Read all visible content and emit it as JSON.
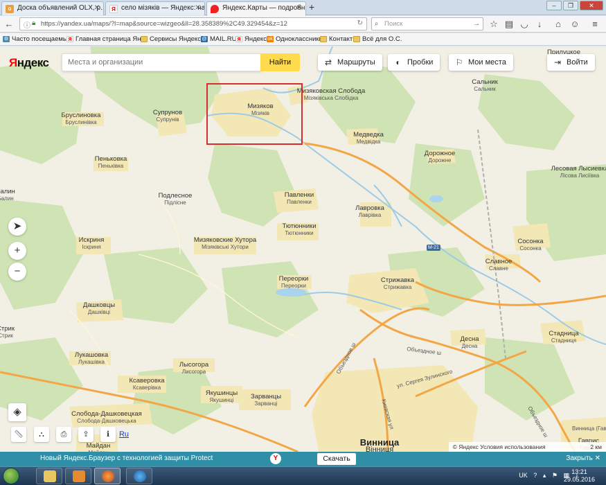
{
  "browser": {
    "tabs": [
      {
        "label": "Доска объявлений OLX, р..."
      },
      {
        "label": "село мізяків — Яндекс: на..."
      },
      {
        "label": "Яндекс.Карты — подробн..."
      }
    ],
    "url": "https://yandex.ua/maps/?l=map&source=wizgeo&ll=28.358389%2C49.329454&z=12",
    "search_placeholder": "Поиск",
    "bookmarks": [
      "Часто посещаемые",
      "Главная страница Ян...",
      "Сервисы Яндекса",
      "MAIL.RU",
      "Яндекс",
      "Одноклассники",
      "Контакт",
      "Всё для О.С."
    ]
  },
  "yandex": {
    "logo_prefix": "Я",
    "logo_rest": "ндекс",
    "search_placeholder": "Места и организации",
    "find_label": "Найти",
    "routes_label": "Маршруты",
    "traffic_label": "Пробки",
    "my_places_label": "Мои места",
    "login_label": "Войти",
    "lang_label": "Ru",
    "copyright": "© Яндекс Условия использования",
    "scale": "2 км"
  },
  "places": [
    {
      "ru": "Мизяков",
      "ua": "Мізяків"
    },
    {
      "ru": "Мизяковская Слобода",
      "ua": "Мізяківська Слобідка"
    },
    {
      "ru": "Супрунов",
      "ua": "Супрунів"
    },
    {
      "ru": "Бруслиновка",
      "ua": "Бруслинівка"
    },
    {
      "ru": "Пеньковка",
      "ua": "Пеньківка"
    },
    {
      "ru": "Медведка",
      "ua": "Медвідка"
    },
    {
      "ru": "Сальник",
      "ua": "Сальник"
    },
    {
      "ru": "Дорожное",
      "ua": "Дорожне"
    },
    {
      "ru": "Лесовая Лысиевка",
      "ua": "Лісова Лисіївка"
    },
    {
      "ru": "Балин",
      "ua": "Балин"
    },
    {
      "ru": "Подлесное",
      "ua": "Підлісне"
    },
    {
      "ru": "Павленки",
      "ua": "Павленки"
    },
    {
      "ru": "Лавровка",
      "ua": "Лаврівка"
    },
    {
      "ru": "Тютюнники",
      "ua": "Тютюнники"
    },
    {
      "ru": "Мизяковские Хутора",
      "ua": "Мізяківські Хутори"
    },
    {
      "ru": "Искриня",
      "ua": "Іскриня"
    },
    {
      "ru": "Сосонка",
      "ua": "Сосонка"
    },
    {
      "ru": "Славное",
      "ua": "Славне"
    },
    {
      "ru": "Переорки",
      "ua": "Переорки"
    },
    {
      "ru": "Стрижавка",
      "ua": "Стрижавка"
    },
    {
      "ru": "Дашковцы",
      "ua": "Дашківці"
    },
    {
      "ru": "Стадница",
      "ua": "Стадниця"
    },
    {
      "ru": "Десна",
      "ua": "Десна"
    },
    {
      "ru": "Лукашовка",
      "ua": "Лукашівка"
    },
    {
      "ru": "Лысогора",
      "ua": "Лисогора"
    },
    {
      "ru": "Ксаверовка",
      "ua": "Ксаверівка"
    },
    {
      "ru": "Якушинцы",
      "ua": "Якушинці"
    },
    {
      "ru": "Зарванцы",
      "ua": "Зарванці"
    },
    {
      "ru": "Слобода-Дашковецкая",
      "ua": "Слобода-Дашковецька"
    },
    {
      "ru": "Майдан",
      "ua": "Майдан"
    },
    {
      "ru": "Винница",
      "ua": "Вінниця"
    },
    {
      "ru": "Гаврис",
      "ua": "Гаврис"
    },
    {
      "ru": "Прилуцкое",
      "ua": "Прилуцьке"
    },
    {
      "ru": "Стрик",
      "ua": "Стрик"
    }
  ],
  "roads": {
    "m21": "М-21",
    "bypass": "Объездное ш",
    "bypass2": "Объездное ш",
    "bypass3": "Объездное ш",
    "zulinskogo": "ул. Сергея Зулинского",
    "kievskaya": "Киевская ул",
    "vinnitsa_caption": "Винница (Гаврис"
  },
  "notification": {
    "text": "Новый Яндекс.Браузер с технологией защиты Protect",
    "download": "Скачать",
    "close": "Закрыть"
  },
  "taskbar": {
    "lang": "UK",
    "time": "13:21",
    "date": "29.05.2016"
  }
}
